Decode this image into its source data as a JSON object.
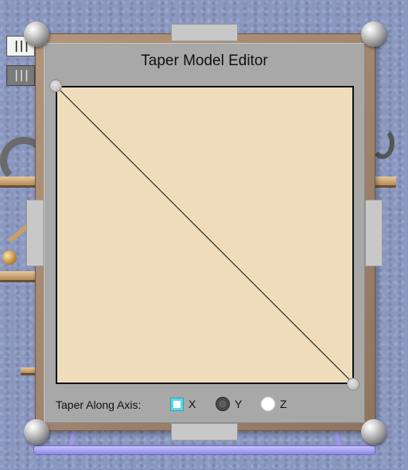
{
  "window": {
    "title": "Taper Model Editor"
  },
  "background": {
    "button_top_glyph": "|||",
    "button_bottom_glyph": "|||"
  },
  "axis": {
    "label": "Taper Along Axis:",
    "selected": "X",
    "options": [
      {
        "label": "X",
        "selected": true
      },
      {
        "label": "Y",
        "selected": false
      },
      {
        "label": "Z",
        "selected": false
      }
    ]
  },
  "colors": {
    "canvas_fill": "#eedcbb",
    "panel": "#a8a8a8",
    "selected_radio": "#5ad7e8",
    "stand": "#9c97f0",
    "frame": "#a38670"
  },
  "icons": {
    "corner": "sphere-icon",
    "handle": "control-point-icon"
  }
}
